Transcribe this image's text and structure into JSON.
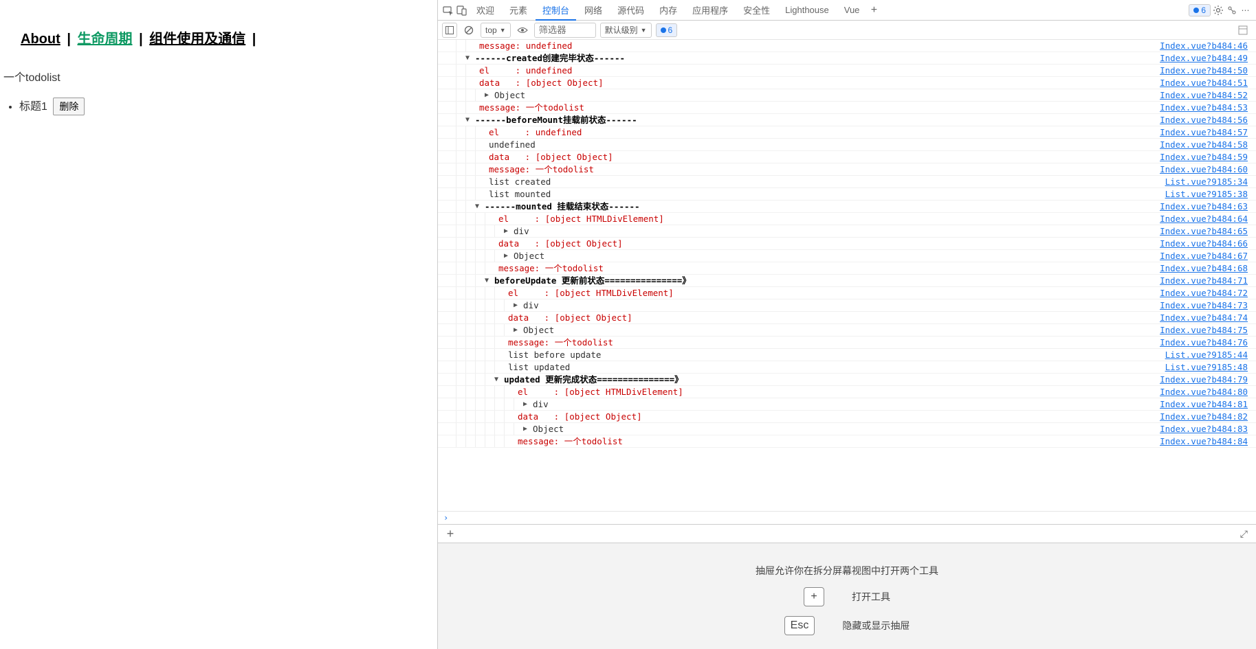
{
  "leftNav": {
    "about": "About",
    "lifecycle": "生命周期",
    "comm": "组件使用及通信"
  },
  "todo": {
    "title": "一个todolist",
    "item1": "标题1",
    "deleteBtn": "删除"
  },
  "tabs": {
    "welcome": "欢迎",
    "elements": "元素",
    "console": "控制台",
    "network": "网络",
    "sources": "源代码",
    "memory": "内存",
    "application": "应用程序",
    "security": "安全性",
    "lighthouse": "Lighthouse",
    "vue": "Vue"
  },
  "badge6": "6",
  "toolbar": {
    "top": "top",
    "filter": "筛选器",
    "level": "默认级别",
    "count6": "6"
  },
  "logs": [
    {
      "indent": 2,
      "arrow": "",
      "cls": "c-red",
      "text": "message: undefined",
      "src": "Index.vue?b484:46"
    },
    {
      "indent": 1,
      "arrow": "▼",
      "cls": "c-bold",
      "text": "------created创建完毕状态------",
      "src": "Index.vue?b484:49"
    },
    {
      "indent": 2,
      "arrow": "",
      "cls": "c-red",
      "text": "el     : undefined",
      "src": "Index.vue?b484:50"
    },
    {
      "indent": 2,
      "arrow": "",
      "cls": "c-red",
      "text": "data   : [object Object]",
      "src": "Index.vue?b484:51"
    },
    {
      "indent": 3,
      "arrow": "▶",
      "cls": "c-black",
      "text": "Object",
      "src": "Index.vue?b484:52"
    },
    {
      "indent": 2,
      "arrow": "",
      "cls": "c-red",
      "text": "message: 一个todolist",
      "src": "Index.vue?b484:53"
    },
    {
      "indent": 1,
      "arrow": "▼",
      "cls": "c-bold",
      "text": "------beforeMount挂载前状态------",
      "src": "Index.vue?b484:56"
    },
    {
      "indent": 3,
      "arrow": "",
      "cls": "c-red",
      "text": "el     : undefined",
      "src": "Index.vue?b484:57"
    },
    {
      "indent": 3,
      "arrow": "",
      "cls": "c-black",
      "text": "undefined",
      "src": "Index.vue?b484:58"
    },
    {
      "indent": 3,
      "arrow": "",
      "cls": "c-red",
      "text": "data   : [object Object]",
      "src": "Index.vue?b484:59"
    },
    {
      "indent": 3,
      "arrow": "",
      "cls": "c-red",
      "text": "message: 一个todolist",
      "src": "Index.vue?b484:60"
    },
    {
      "indent": 3,
      "arrow": "",
      "cls": "c-black",
      "text": "list created",
      "src": "List.vue?9185:34"
    },
    {
      "indent": 3,
      "arrow": "",
      "cls": "c-black",
      "text": "list mounted",
      "src": "List.vue?9185:38"
    },
    {
      "indent": 2,
      "arrow": "▼",
      "cls": "c-bold",
      "text": "------mounted 挂载结束状态------",
      "src": "Index.vue?b484:63"
    },
    {
      "indent": 4,
      "arrow": "",
      "cls": "c-red",
      "text": "el     : [object HTMLDivElement]",
      "src": "Index.vue?b484:64"
    },
    {
      "indent": 5,
      "arrow": "▶",
      "cls": "c-black",
      "text": "div",
      "src": "Index.vue?b484:65"
    },
    {
      "indent": 4,
      "arrow": "",
      "cls": "c-red",
      "text": "data   : [object Object]",
      "src": "Index.vue?b484:66"
    },
    {
      "indent": 5,
      "arrow": "▶",
      "cls": "c-black",
      "text": "Object",
      "src": "Index.vue?b484:67"
    },
    {
      "indent": 4,
      "arrow": "",
      "cls": "c-red",
      "text": "message: 一个todolist",
      "src": "Index.vue?b484:68"
    },
    {
      "indent": 3,
      "arrow": "▼",
      "cls": "c-bold",
      "text": "beforeUpdate 更新前状态===============》",
      "src": "Index.vue?b484:71"
    },
    {
      "indent": 5,
      "arrow": "",
      "cls": "c-red",
      "text": "el     : [object HTMLDivElement]",
      "src": "Index.vue?b484:72"
    },
    {
      "indent": 6,
      "arrow": "▶",
      "cls": "c-black",
      "text": "div",
      "src": "Index.vue?b484:73"
    },
    {
      "indent": 5,
      "arrow": "",
      "cls": "c-red",
      "text": "data   : [object Object]",
      "src": "Index.vue?b484:74"
    },
    {
      "indent": 6,
      "arrow": "▶",
      "cls": "c-black",
      "text": "Object",
      "src": "Index.vue?b484:75"
    },
    {
      "indent": 5,
      "arrow": "",
      "cls": "c-red",
      "text": "message: 一个todolist",
      "src": "Index.vue?b484:76"
    },
    {
      "indent": 5,
      "arrow": "",
      "cls": "c-black",
      "text": "list before update",
      "src": "List.vue?9185:44"
    },
    {
      "indent": 5,
      "arrow": "",
      "cls": "c-black",
      "text": "list updated",
      "src": "List.vue?9185:48"
    },
    {
      "indent": 4,
      "arrow": "▼",
      "cls": "c-bold",
      "text": "updated 更新完成状态===============》",
      "src": "Index.vue?b484:79"
    },
    {
      "indent": 6,
      "arrow": "",
      "cls": "c-red",
      "text": "el     : [object HTMLDivElement]",
      "src": "Index.vue?b484:80"
    },
    {
      "indent": 7,
      "arrow": "▶",
      "cls": "c-black",
      "text": "div",
      "src": "Index.vue?b484:81"
    },
    {
      "indent": 6,
      "arrow": "",
      "cls": "c-red",
      "text": "data   : [object Object]",
      "src": "Index.vue?b484:82"
    },
    {
      "indent": 7,
      "arrow": "▶",
      "cls": "c-black",
      "text": "Object",
      "src": "Index.vue?b484:83"
    },
    {
      "indent": 6,
      "arrow": "",
      "cls": "c-red",
      "text": "message: 一个todolist",
      "src": "Index.vue?b484:84"
    }
  ],
  "drawer": {
    "hint": "抽屉允许你在拆分屏幕视图中打开两个工具",
    "plus": "+",
    "openTool": "打开工具",
    "esc": "Esc",
    "toggle": "隐藏或显示抽屉"
  }
}
